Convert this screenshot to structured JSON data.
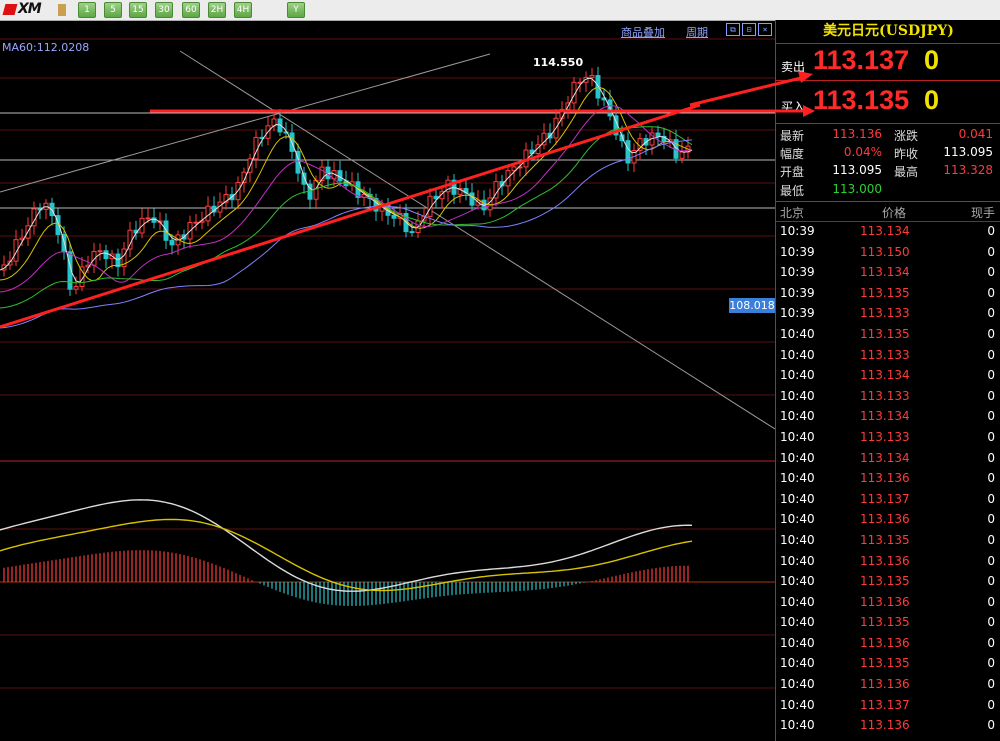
{
  "toolbar": {
    "logo_text": "XM",
    "periods": [
      "1",
      "5",
      "15",
      "30",
      "60",
      "2H",
      "4H",
      "Y"
    ],
    "overlay_label": "商品叠加",
    "period_label": "周期"
  },
  "chart": {
    "ma_label": "MA60:112.0208",
    "peak_label": "114.550",
    "price_tag": "108.018"
  },
  "panel": {
    "title": "美元日元(USDJPY)",
    "sell": {
      "label": "卖出",
      "price": "113.137",
      "vol": "0"
    },
    "buy": {
      "label": "买入",
      "price": "113.135",
      "vol": "0"
    },
    "stats": {
      "latest_label": "最新",
      "latest": "113.136",
      "change_label": "涨跌",
      "change": "0.041",
      "range_label": "幅度",
      "range": "0.04%",
      "prev_close_label": "昨收",
      "prev_close": "113.095",
      "open_label": "开盘",
      "open": "113.095",
      "high_label": "最高",
      "high": "113.328",
      "low_label": "最低",
      "low": "113.000"
    },
    "ticks_header": {
      "time": "北京",
      "price": "价格",
      "volume": "现手"
    },
    "ticks": [
      {
        "time": "10:39",
        "price": "113.134",
        "volume": "0"
      },
      {
        "time": "10:39",
        "price": "113.150",
        "volume": "0"
      },
      {
        "time": "10:39",
        "price": "113.134",
        "volume": "0"
      },
      {
        "time": "10:39",
        "price": "113.135",
        "volume": "0"
      },
      {
        "time": "10:39",
        "price": "113.133",
        "volume": "0"
      },
      {
        "time": "10:40",
        "price": "113.135",
        "volume": "0"
      },
      {
        "time": "10:40",
        "price": "113.133",
        "volume": "0"
      },
      {
        "time": "10:40",
        "price": "113.134",
        "volume": "0"
      },
      {
        "time": "10:40",
        "price": "113.133",
        "volume": "0"
      },
      {
        "time": "10:40",
        "price": "113.134",
        "volume": "0"
      },
      {
        "time": "10:40",
        "price": "113.133",
        "volume": "0"
      },
      {
        "time": "10:40",
        "price": "113.134",
        "volume": "0"
      },
      {
        "time": "10:40",
        "price": "113.136",
        "volume": "0"
      },
      {
        "time": "10:40",
        "price": "113.137",
        "volume": "0"
      },
      {
        "time": "10:40",
        "price": "113.136",
        "volume": "0"
      },
      {
        "time": "10:40",
        "price": "113.135",
        "volume": "0"
      },
      {
        "time": "10:40",
        "price": "113.136",
        "volume": "0"
      },
      {
        "time": "10:40",
        "price": "113.135",
        "volume": "0"
      },
      {
        "time": "10:40",
        "price": "113.136",
        "volume": "0"
      },
      {
        "time": "10:40",
        "price": "113.135",
        "volume": "0"
      },
      {
        "time": "10:40",
        "price": "113.136",
        "volume": "0"
      },
      {
        "time": "10:40",
        "price": "113.135",
        "volume": "0"
      },
      {
        "time": "10:40",
        "price": "113.136",
        "volume": "0"
      },
      {
        "time": "10:40",
        "price": "113.137",
        "volume": "0"
      },
      {
        "time": "10:40",
        "price": "113.136",
        "volume": "0"
      }
    ]
  },
  "colors": {
    "up": "#ff3b3b",
    "down": "#27c4c9",
    "accent": "#f2e200",
    "divider": "#bb2222"
  }
}
